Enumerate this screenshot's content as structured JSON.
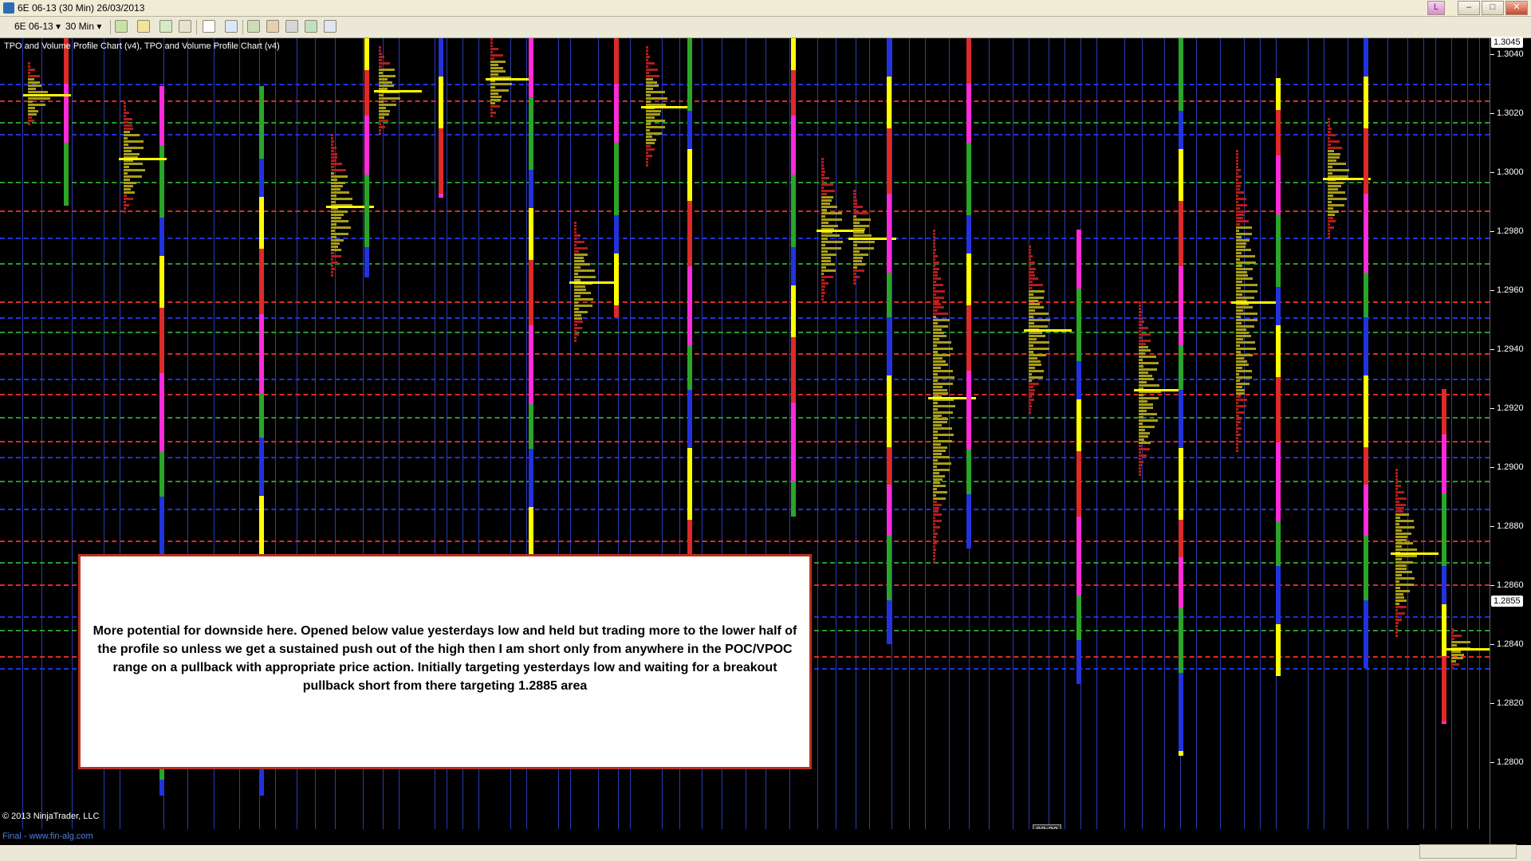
{
  "window": {
    "title": "6E 06-13 (30 Min)  26/03/2013",
    "buttons": {
      "l": "L",
      "minimize": "–",
      "restore": "□",
      "close": "✕"
    }
  },
  "toolbar": {
    "instrument": "6E 06-13",
    "interval": "30 Min"
  },
  "chart": {
    "header": "TPO and Volume Profile Chart (v4),  TPO and Volume Profile Chart (v4)",
    "copyright": "© 2013 NinjaTrader, LLC",
    "status_left": "Final - www.fin-alg.com",
    "time_marker": "02:30",
    "annotation": "More potential for downside here. Opened below value yesterdays low and held but trading more to the lower half of the profile so unless we get a sustained push out of the high then I am short only from anywhere in the POC/VPOC range on a pullback with appropriate price action. Initially targeting yesterdays low and waiting for a breakout pullback short from there targeting 1.2885 area",
    "colors": {
      "value_area": "#a89e1a",
      "poc": "#ffff00",
      "vah": "#dd2a2a",
      "val_blue": "#2233dd",
      "green": "#2aa52a",
      "magenta": "#ff2bd9"
    }
  },
  "axis": {
    "top_tag": "1.3045",
    "current_tag": "1.2855",
    "ticks": [
      "1.3040",
      "1.3020",
      "1.3000",
      "1.2980",
      "1.2960",
      "1.2940",
      "1.2920",
      "1.2900",
      "1.2880",
      "1.2860",
      "1.2840",
      "1.2820",
      "1.2800"
    ]
  }
}
